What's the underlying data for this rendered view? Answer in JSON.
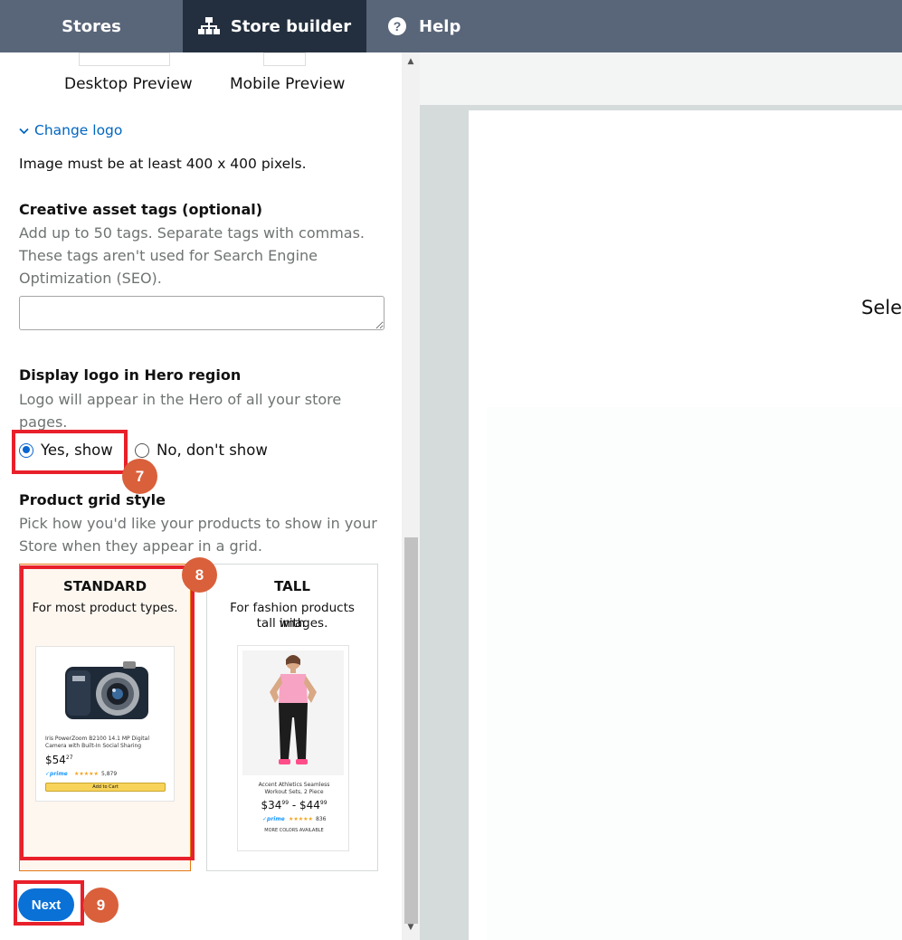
{
  "nav": {
    "stores": "Stores",
    "store_builder": "Store builder",
    "help": "Help"
  },
  "preview_options": {
    "desktop": "Desktop Preview",
    "mobile": "Mobile Preview"
  },
  "logo": {
    "change_logo": "Change logo",
    "requirement": "Image must be at least 400 x 400 pixels."
  },
  "tags": {
    "heading": "Creative asset tags (optional)",
    "help_line1": "Add up to 50 tags. Separate tags with commas.",
    "help_line2": "These tags aren't used for Search Engine",
    "help_line3": "Optimization (SEO).",
    "value": ""
  },
  "hero_logo": {
    "heading": "Display logo in Hero region",
    "help_line1": "Logo will appear in the Hero of all your store",
    "help_line2": "pages.",
    "options": [
      "Yes, show",
      "No, don't show"
    ],
    "selected": "Yes, show"
  },
  "grid_style": {
    "heading": "Product grid style",
    "help_line1": "Pick how you'd like your products to show in your",
    "help_line2": "Store when they appear in a grid.",
    "standard": {
      "title": "STANDARD",
      "desc": "For most product types.",
      "product_name_line1": "Iris PowerZoom B2100 14.1 MP Digital",
      "product_name_line2": "Camera with Built-In Social Sharing",
      "price": "$54",
      "price_cents": "27",
      "prime": "✓prime",
      "rating_count": "5,879",
      "button": "Add to Cart"
    },
    "tall": {
      "title": "TALL",
      "desc_line1": "For fashion products with",
      "desc_line2": "tall images.",
      "product_name_line1": "Accent Athletics Seamless",
      "product_name_line2": "Workout Sets, 2 Piece",
      "price": "$34",
      "price_cents": "99",
      "price_to": " - $44",
      "price_to_cents": "99",
      "prime": "✓prime",
      "rating_count": "836",
      "more_colors": "MORE COLORS AVAILABLE"
    }
  },
  "next_button": "Next",
  "annotations": [
    "7",
    "8",
    "9"
  ],
  "preview_pane": {
    "partial_text": "Sele"
  },
  "colors": {
    "nav_bg": "#596679",
    "nav_active": "#232f3e",
    "link": "#0066c0",
    "primary_button": "#0a71d6",
    "highlight": "#e8202a",
    "badge": "#d9603b",
    "selected_card_border": "#e47911"
  }
}
